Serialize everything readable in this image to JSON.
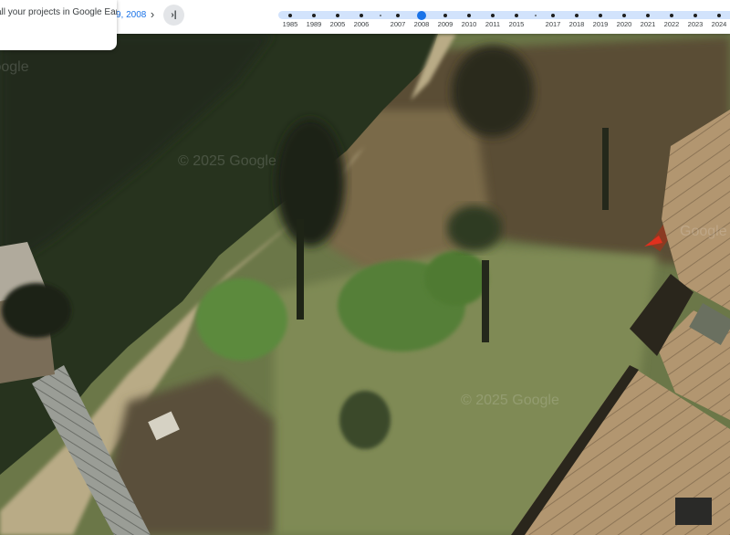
{
  "info_card": {
    "text": "all your projects in Google Earth."
  },
  "nav": {
    "date_label": "9, 2008",
    "next_icon": "chevron-right-icon",
    "last_icon": "skip-to-end-icon",
    "next_symbol": "›",
    "last_symbol": "›|"
  },
  "timeline": {
    "selected": "2008",
    "years": [
      {
        "label": "1985",
        "kind": "year"
      },
      {
        "label": "1989",
        "kind": "year"
      },
      {
        "label": "2005",
        "kind": "year"
      },
      {
        "label": "2006",
        "kind": "year"
      },
      {
        "label": "",
        "kind": "minor"
      },
      {
        "label": "2007",
        "kind": "year"
      },
      {
        "label": "2008",
        "kind": "year"
      },
      {
        "label": "2009",
        "kind": "year"
      },
      {
        "label": "2010",
        "kind": "year"
      },
      {
        "label": "2011",
        "kind": "year"
      },
      {
        "label": "2015",
        "kind": "year"
      },
      {
        "label": "",
        "kind": "minor"
      },
      {
        "label": "2017",
        "kind": "year"
      },
      {
        "label": "2018",
        "kind": "year"
      },
      {
        "label": "2019",
        "kind": "year"
      },
      {
        "label": "2020",
        "kind": "year"
      },
      {
        "label": "2021",
        "kind": "year"
      },
      {
        "label": "2022",
        "kind": "year"
      },
      {
        "label": "2023",
        "kind": "year"
      },
      {
        "label": "2024",
        "kind": "year"
      }
    ]
  },
  "watermarks": [
    "© 2025 Google",
    "© 2025 Google",
    "Google",
    "Google"
  ],
  "colors": {
    "accent": "#1a73e8",
    "timeline_track": "#d2e3fc"
  }
}
